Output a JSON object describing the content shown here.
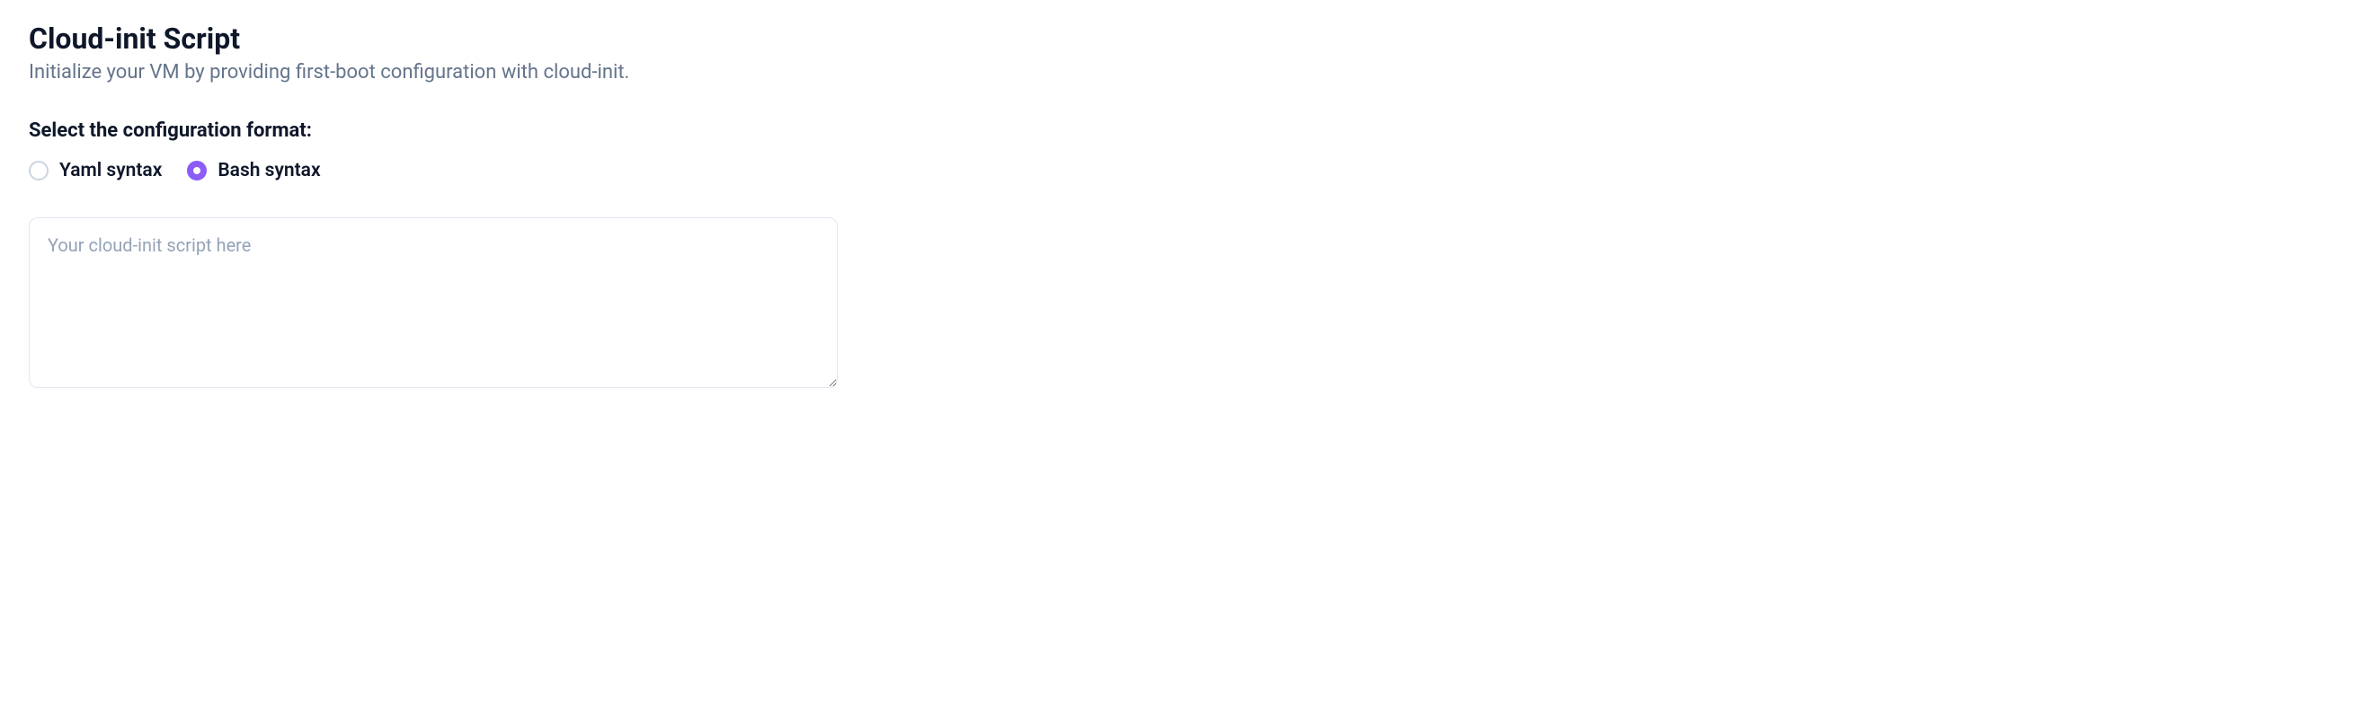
{
  "section": {
    "title": "Cloud-init Script",
    "description": "Initialize your VM by providing first-boot configuration with cloud-init."
  },
  "format": {
    "label": "Select the configuration format:",
    "options": [
      {
        "label": "Yaml syntax",
        "selected": false
      },
      {
        "label": "Bash syntax",
        "selected": true
      }
    ]
  },
  "textarea": {
    "placeholder": "Your cloud-init script here",
    "value": ""
  }
}
